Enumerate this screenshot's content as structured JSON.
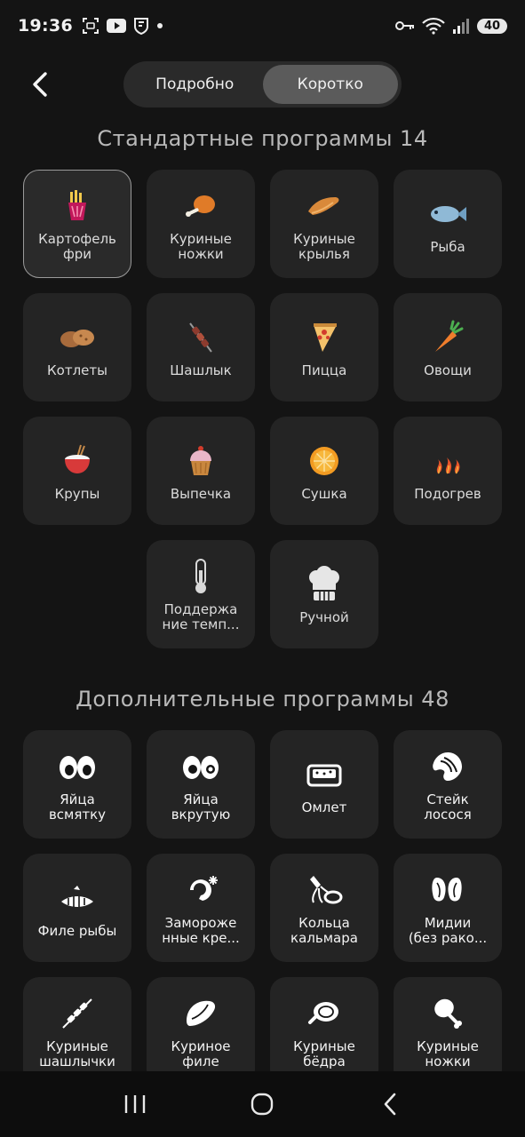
{
  "status": {
    "time": "19:36",
    "battery": "40"
  },
  "header": {
    "tabs": [
      {
        "label": "Подробно"
      },
      {
        "label": "Коротко"
      }
    ]
  },
  "standard": {
    "title": "Стандартные программы 14",
    "items": [
      {
        "label": "Картофель\nфри",
        "icon": "fries-icon"
      },
      {
        "label": "Куриные\nножки",
        "icon": "chicken-leg-icon"
      },
      {
        "label": "Куриные\nкрылья",
        "icon": "chicken-wing-icon"
      },
      {
        "label": "Рыба",
        "icon": "fish-icon"
      },
      {
        "label": "Котлеты",
        "icon": "cutlets-icon"
      },
      {
        "label": "Шашлык",
        "icon": "skewer-icon"
      },
      {
        "label": "Пицца",
        "icon": "pizza-icon"
      },
      {
        "label": "Овощи",
        "icon": "carrot-icon"
      },
      {
        "label": "Крупы",
        "icon": "rice-bowl-icon"
      },
      {
        "label": "Выпечка",
        "icon": "cupcake-icon"
      },
      {
        "label": "Сушка",
        "icon": "orange-slice-icon"
      },
      {
        "label": "Подогрев",
        "icon": "heat-icon"
      },
      {
        "label": "Поддержа\nние темп...",
        "icon": "thermometer-icon"
      },
      {
        "label": "Ручной",
        "icon": "chef-hat-icon"
      }
    ]
  },
  "extra": {
    "title": "Дополнительные программы 48",
    "items": [
      {
        "label": "Яйца\nвсмятку",
        "icon": "soft-eggs-icon"
      },
      {
        "label": "Яйца\nвкрутую",
        "icon": "hard-eggs-icon"
      },
      {
        "label": "Омлет",
        "icon": "omelet-dish-icon"
      },
      {
        "label": "Стейк\nлосося",
        "icon": "salmon-steak-icon"
      },
      {
        "label": "Филе рыбы",
        "icon": "fish-fillet-icon"
      },
      {
        "label": "Заморoже\nнные кре...",
        "icon": "frozen-shrimp-icon"
      },
      {
        "label": "Кольца\nкальмара",
        "icon": "squid-icon"
      },
      {
        "label": "Мидии\n(без рако...",
        "icon": "mussels-icon"
      },
      {
        "label": "Куриные\nшашлычки",
        "icon": "chicken-skewer-icon"
      },
      {
        "label": "Куриное\nфиле",
        "icon": "chicken-fillet-icon"
      },
      {
        "label": "Куриные\nбёдра",
        "icon": "chicken-thigh-icon"
      },
      {
        "label": "Куриные\nножки",
        "icon": "drumstick-icon"
      }
    ]
  }
}
